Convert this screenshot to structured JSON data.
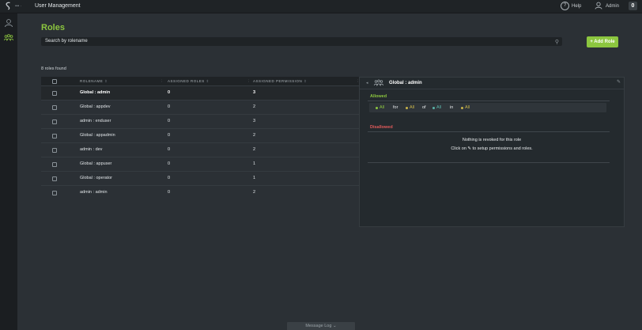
{
  "header": {
    "app_switcher": "••• ·",
    "title": "User Management",
    "help_label": "Help",
    "user_label": "Admin",
    "notification_count": "0"
  },
  "page": {
    "title": "Roles",
    "search_placeholder": "Search by rolename",
    "add_button_label": "+ Add Role",
    "count_text": "8 roles found"
  },
  "table": {
    "columns": [
      "ROLENAME",
      "ASSIGNED ROLES",
      "ASSIGNED PERMISSION"
    ],
    "rows": [
      {
        "name": "Global : admin",
        "roles": "0",
        "permissions": "3"
      },
      {
        "name": "Global : appdev",
        "roles": "0",
        "permissions": "2"
      },
      {
        "name": "admin : enduser",
        "roles": "0",
        "permissions": "3"
      },
      {
        "name": "Global : appadmin",
        "roles": "0",
        "permissions": "2"
      },
      {
        "name": "admin : dev",
        "roles": "0",
        "permissions": "2"
      },
      {
        "name": "Global : appuser",
        "roles": "0",
        "permissions": "1"
      },
      {
        "name": "Global : operator",
        "roles": "0",
        "permissions": "1"
      },
      {
        "name": "admin : admin",
        "roles": "0",
        "permissions": "2"
      }
    ]
  },
  "detail": {
    "title": "Global : admin",
    "allowed_label": "Allowed",
    "disallowed_label": "Disallowed",
    "permission": {
      "item1": "All",
      "for": "for",
      "item2": "All",
      "of": "of",
      "item3": "All",
      "in": "in",
      "item4": "All"
    },
    "empty_message": "Nothing is revoked for this role",
    "hint_prefix": "Click on",
    "hint_suffix": "to setup permissions and roles."
  },
  "footer": {
    "message_log": "Message Log"
  },
  "colors": {
    "accent": "#8cc63f",
    "danger": "#e05a5a",
    "dot_green": "#8cc63f",
    "dot_yellow": "#c8b44a",
    "dot_teal": "#5ab3a8"
  },
  "icons": [
    "logo-icon",
    "help-icon",
    "user-icon",
    "roles-icon",
    "search-icon",
    "sort-icon",
    "edit-icon",
    "collapse-icon"
  ]
}
